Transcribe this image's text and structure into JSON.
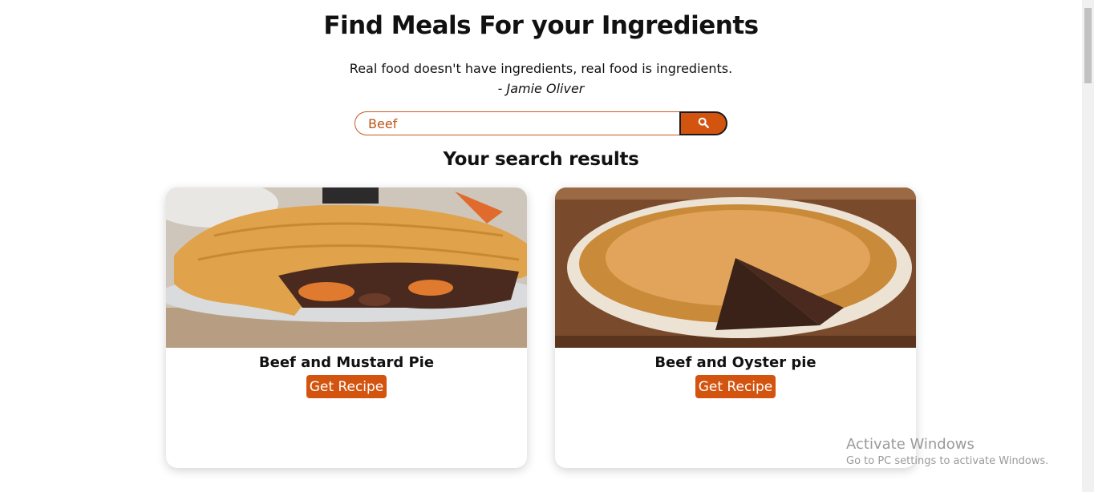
{
  "header": {
    "title": "Find Meals For your Ingredients",
    "quote": "Real food doesn't have ingredients, real food is ingredients.",
    "author": "- Jamie Oliver"
  },
  "search": {
    "value": "Beef",
    "button_icon": "search-icon"
  },
  "results": {
    "heading": "Your search results",
    "cards": [
      {
        "title": "Beef and Mustard Pie",
        "button_label": "Get Recipe",
        "image": "beef-mustard-pie-photo"
      },
      {
        "title": "Beef and Oyster pie",
        "button_label": "Get Recipe",
        "image": "beef-oyster-pie-photo"
      }
    ]
  },
  "colors": {
    "accent": "#d2540f",
    "text": "#111111",
    "input_border": "#c85a1e"
  },
  "watermark": {
    "line1": "Activate Windows",
    "line2": "Go to PC settings to activate Windows."
  }
}
